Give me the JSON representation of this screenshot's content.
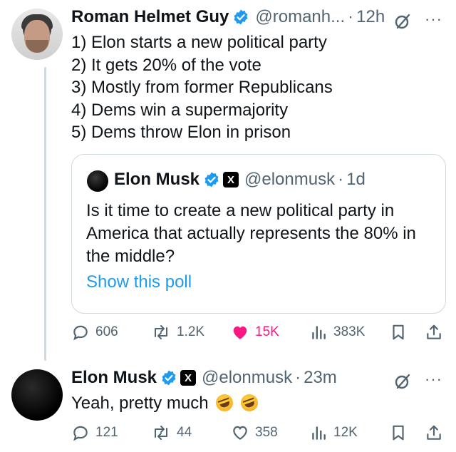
{
  "tweet1": {
    "name": "Roman Helmet Guy",
    "handle": "@romanh...",
    "time": "12h",
    "lines": [
      "1) Elon starts a new political party",
      "2) It gets 20% of the vote",
      "3) Mostly from former Republicans",
      "4) Dems win a supermajority",
      "5) Dems throw Elon in prison"
    ],
    "quote": {
      "name": "Elon Musk",
      "badge": "X",
      "handle": "@elonmusk",
      "time": "1d",
      "text": "Is it time to create a new political party in America that actually represents the 80% in the middle?",
      "poll_link": "Show this poll"
    },
    "actions": {
      "replies": "606",
      "reposts": "1.2K",
      "likes": "15K",
      "views": "383K"
    }
  },
  "tweet2": {
    "name": "Elon Musk",
    "badge": "X",
    "handle": "@elonmusk",
    "time": "23m",
    "text": "Yeah, pretty much",
    "actions": {
      "replies": "121",
      "reposts": "44",
      "likes": "358",
      "views": "12K"
    }
  },
  "colors": {
    "accent": "#1d9bf0",
    "like": "#f91880",
    "muted": "#536471",
    "border": "#cfd9de"
  },
  "icons": [
    "verified-icon",
    "x-badge-icon",
    "grok-icon",
    "more-icon",
    "reply-icon",
    "repost-icon",
    "like-icon",
    "views-icon",
    "bookmark-icon",
    "share-icon",
    "rofl-emoji-icon"
  ]
}
